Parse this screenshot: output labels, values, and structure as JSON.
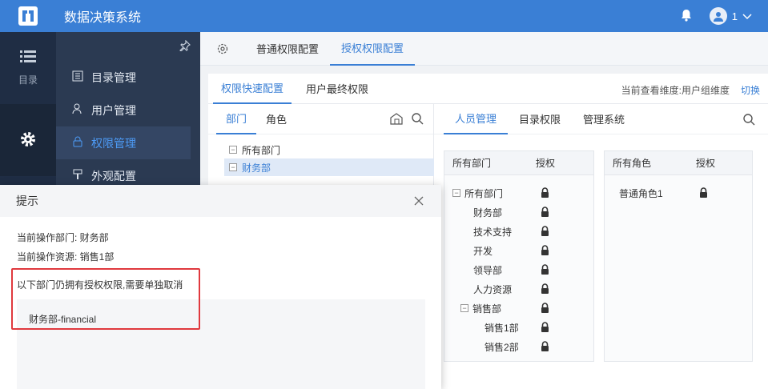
{
  "app": {
    "title": "数据决策系统",
    "user_name": "1"
  },
  "rail": {
    "items": [
      {
        "label": "目录"
      }
    ]
  },
  "nav": {
    "items": [
      {
        "label": "目录管理"
      },
      {
        "label": "用户管理"
      },
      {
        "label": "权限管理"
      },
      {
        "label": "外观配置"
      }
    ]
  },
  "main_tabs": [
    {
      "label": "普通权限配置"
    },
    {
      "label": "授权权限配置"
    }
  ],
  "sub_tabs": [
    {
      "label": "权限快速配置"
    },
    {
      "label": "用户最终权限"
    }
  ],
  "dimension_info": "当前查看维度:用户组维度",
  "switch_label": "切换",
  "left_tabs": [
    {
      "label": "部门"
    },
    {
      "label": "角色"
    }
  ],
  "left_tree": [
    {
      "label": "所有部门"
    },
    {
      "label": "财务部"
    }
  ],
  "right_tabs": [
    {
      "label": "人员管理"
    },
    {
      "label": "目录权限"
    },
    {
      "label": "管理系统"
    }
  ],
  "dept_card": {
    "col_name": "所有部门",
    "col_auth": "授权",
    "rows": [
      {
        "label": "所有部门"
      },
      {
        "label": "财务部"
      },
      {
        "label": "技术支持"
      },
      {
        "label": "开发"
      },
      {
        "label": "领导部"
      },
      {
        "label": "人力资源"
      },
      {
        "label": "销售部"
      },
      {
        "label": "销售1部"
      },
      {
        "label": "销售2部"
      }
    ]
  },
  "role_card": {
    "col_name": "所有角色",
    "col_auth": "授权",
    "rows": [
      {
        "label": "普通角色1"
      }
    ]
  },
  "dialog": {
    "title": "提示",
    "line1": "当前操作部门: 财务部",
    "line2": "当前操作资源: 销售1部",
    "line3": "以下部门仍拥有授权权限,需要单独取消",
    "items": [
      "财务部-financial"
    ]
  },
  "colors": {
    "header": "#3a7fd5",
    "accent": "#3a7fd5",
    "highlight": "#e0393e"
  }
}
